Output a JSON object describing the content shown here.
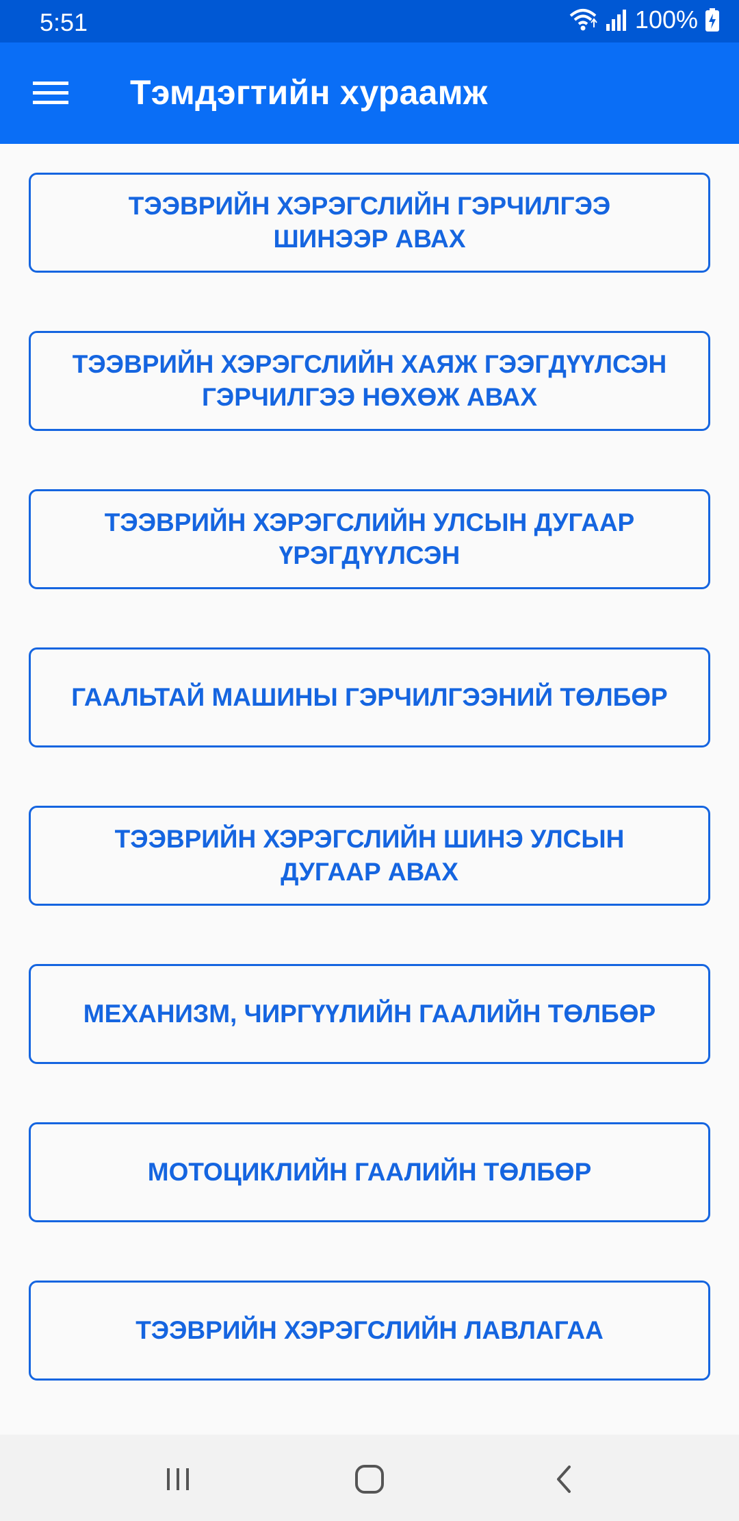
{
  "status_bar": {
    "time": "5:51",
    "battery": "100%",
    "icons": [
      "wifi-icon",
      "signal-icon",
      "battery-charging-icon"
    ]
  },
  "app_bar": {
    "title": "Тэмдэгтийн хураамж",
    "menu_icon": "hamburger-menu-icon",
    "color": "#0a6ef6"
  },
  "menu": {
    "accent_color": "#1565e0",
    "items": [
      {
        "line1": "ТЭЭВРИЙН ХЭРЭГСЛИЙН ГЭРЧИЛГЭЭ",
        "line2": "ШИНЭЭР АВАХ"
      },
      {
        "line1": "ТЭЭВРИЙН ХЭРЭГСЛИЙН ХАЯЖ ГЭЭГДҮҮЛСЭН",
        "line2": "ГЭРЧИЛГЭЭ НӨХӨЖ АВАХ"
      },
      {
        "line1": "ТЭЭВРИЙН ХЭРЭГСЛИЙН УЛСЫН ДУГААР",
        "line2": "ҮРЭГДҮҮЛСЭН"
      },
      {
        "line1": "ГААЛЬТАЙ МАШИНЫ ГЭРЧИЛГЭЭНИЙ ТӨЛБӨР",
        "line2": ""
      },
      {
        "line1": "ТЭЭВРИЙН ХЭРЭГСЛИЙН ШИНЭ УЛСЫН",
        "line2": "ДУГААР АВАХ"
      },
      {
        "line1": "МЕХАНИЗМ, ЧИРГҮҮЛИЙН ГААЛИЙН ТӨЛБӨР",
        "line2": ""
      },
      {
        "line1": "МОТОЦИКЛИЙН ГААЛИЙН ТӨЛБӨР",
        "line2": ""
      },
      {
        "line1": "ТЭЭВРИЙН ХЭРЭГСЛИЙН ЛАВЛАГАА",
        "line2": ""
      }
    ]
  },
  "nav_bar": {
    "icons": [
      "recent-apps-icon",
      "home-icon",
      "back-icon"
    ]
  }
}
